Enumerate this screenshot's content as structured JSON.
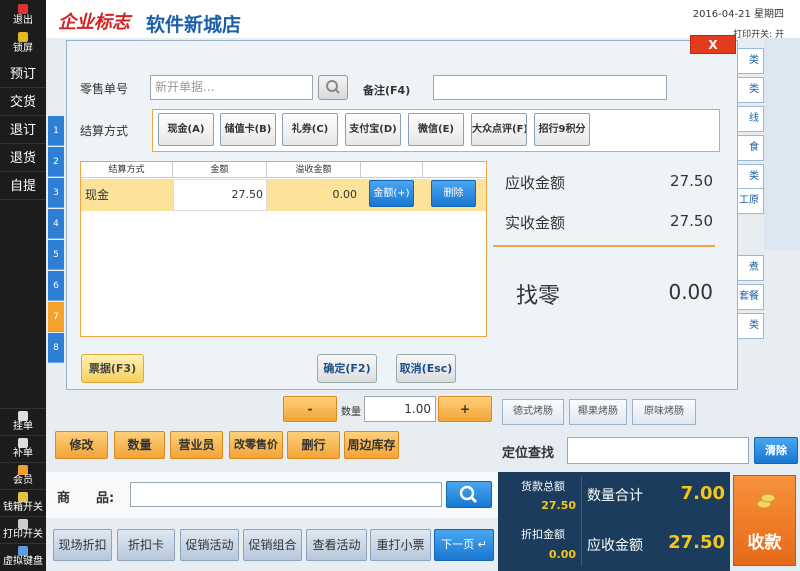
{
  "sidebar": {
    "exit": "退出",
    "lock": "锁屏",
    "items": [
      "预订",
      "交货",
      "退订",
      "退货",
      "自提"
    ],
    "bottom": [
      "挂单",
      "补单",
      "会员",
      "钱箱开关",
      "打印开关",
      "虚拟键盘"
    ]
  },
  "header": {
    "logo": "企业标志",
    "shop_name": "软件新城店",
    "date": "2016-04-21 星期四",
    "print_state": "打印开关: 开"
  },
  "row_numbers": [
    "1",
    "2",
    "3",
    "4",
    "5",
    "6",
    "7",
    "8"
  ],
  "category_tabs": [
    "类",
    "类",
    "线",
    "食",
    "类",
    "工原",
    "煮",
    "套餐",
    "类"
  ],
  "dialog": {
    "close_label": "X",
    "order_label": "零售单号",
    "order_placeholder": "新开单据...",
    "remark_label": "备注(F4)",
    "remark_value": "",
    "method_label": "结算方式",
    "pay_methods": [
      "现金(A)",
      "储值卡(B)",
      "礼券(C)",
      "支付宝(D)",
      "微信(E)",
      "大众点评(F)",
      "招行9积分"
    ],
    "table": {
      "headers": [
        "结算方式",
        "金额",
        "溢收金额"
      ],
      "rows": [
        {
          "method": "现金",
          "amount": "27.50",
          "overflow": "0.00",
          "amount_btn": "金额(+)",
          "delete_btn": "删除"
        }
      ]
    },
    "summary": {
      "receivable_label": "应收金额",
      "receivable_value": "27.50",
      "received_label": "实收金额",
      "received_value": "27.50",
      "change_label": "找零",
      "change_value": "0.00"
    },
    "receipt_btn": "票据(F3)",
    "confirm_btn": "确定(F2)",
    "cancel_btn": "取消(Esc)"
  },
  "qty_area": {
    "minus": "-",
    "label": "数量",
    "value": "1.00",
    "plus": "+"
  },
  "tools": [
    "修改",
    "数量",
    "营业员",
    "改零售价",
    "删行",
    "周边库存"
  ],
  "product": {
    "label": "商　　品:",
    "placeholder": ""
  },
  "footer_buttons": [
    "现场折扣",
    "折扣卡",
    "促销活动",
    "促销组合",
    "查看活动",
    "重打小票"
  ],
  "next_page": "下一页",
  "sausages": [
    "德式烤肠",
    "椰果烤肠",
    "原味烤肠"
  ],
  "locate": {
    "label": "定位查找",
    "value": "",
    "clear_btn": "清除"
  },
  "totals": {
    "goods_total_label": "货款总额",
    "goods_total_value": "27.50",
    "discount_label": "折扣金额",
    "discount_value": "0.00",
    "qty_label": "数量合计",
    "qty_value": "7.00",
    "receivable_label": "应收金额",
    "receivable_value": "27.50",
    "checkout_btn": "收款"
  }
}
